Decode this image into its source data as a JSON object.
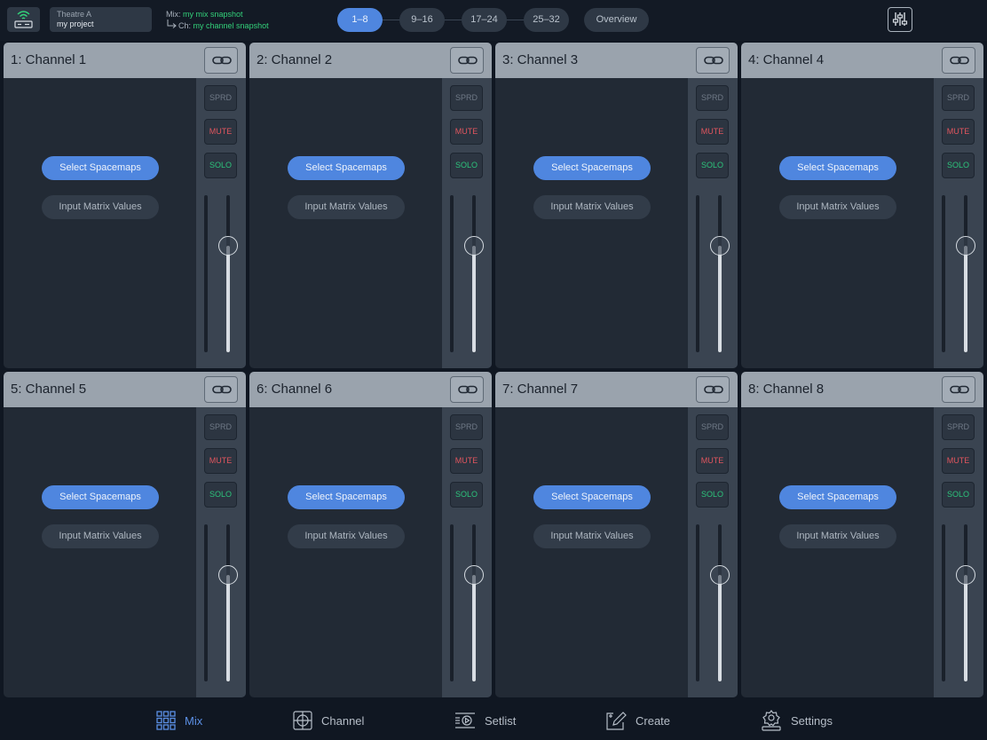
{
  "header": {
    "device_icon": "wireless-device-icon",
    "venue": "Theatre A",
    "project": "my project",
    "mix_label": "Mix:",
    "mix_snapshot": "my mix snapshot",
    "ch_label": "Ch:",
    "channel_snapshot": "my channel snapshot",
    "pages": [
      "1–8",
      "9–16",
      "17–24",
      "25–32"
    ],
    "active_page": "1–8",
    "overview_label": "Overview",
    "mixer_icon": "mixer-sliders-icon"
  },
  "channels": [
    {
      "title": "1:  Channel 1",
      "select_label": "Select Spacemaps",
      "matrix_label": "Input Matrix Values",
      "sprd": "SPRD",
      "mute": "MUTE",
      "solo": "SOLO",
      "fader_level": 0.68
    },
    {
      "title": "2:  Channel 2",
      "select_label": "Select Spacemaps",
      "matrix_label": "Input Matrix Values",
      "sprd": "SPRD",
      "mute": "MUTE",
      "solo": "SOLO",
      "fader_level": 0.68
    },
    {
      "title": "3:  Channel 3",
      "select_label": "Select Spacemaps",
      "matrix_label": "Input Matrix Values",
      "sprd": "SPRD",
      "mute": "MUTE",
      "solo": "SOLO",
      "fader_level": 0.68
    },
    {
      "title": "4:  Channel 4",
      "select_label": "Select Spacemaps",
      "matrix_label": "Input Matrix Values",
      "sprd": "SPRD",
      "mute": "MUTE",
      "solo": "SOLO",
      "fader_level": 0.68
    },
    {
      "title": "5:  Channel 5",
      "select_label": "Select Spacemaps",
      "matrix_label": "Input Matrix Values",
      "sprd": "SPRD",
      "mute": "MUTE",
      "solo": "SOLO",
      "fader_level": 0.68
    },
    {
      "title": "6:  Channel 6",
      "select_label": "Select Spacemaps",
      "matrix_label": "Input Matrix Values",
      "sprd": "SPRD",
      "mute": "MUTE",
      "solo": "SOLO",
      "fader_level": 0.68
    },
    {
      "title": "7:  Channel 7",
      "select_label": "Select Spacemaps",
      "matrix_label": "Input Matrix Values",
      "sprd": "SPRD",
      "mute": "MUTE",
      "solo": "SOLO",
      "fader_level": 0.68
    },
    {
      "title": "8:  Channel 8",
      "select_label": "Select Spacemaps",
      "matrix_label": "Input Matrix Values",
      "sprd": "SPRD",
      "mute": "MUTE",
      "solo": "SOLO",
      "fader_level": 0.68
    }
  ],
  "tabs": [
    {
      "label": "Mix",
      "icon": "mix-grid-icon",
      "active": true
    },
    {
      "label": "Channel",
      "icon": "channel-target-icon",
      "active": false
    },
    {
      "label": "Setlist",
      "icon": "setlist-icon",
      "active": false
    },
    {
      "label": "Create",
      "icon": "create-pencil-icon",
      "active": false
    },
    {
      "label": "Settings",
      "icon": "settings-gear-icon",
      "active": false
    }
  ],
  "colors": {
    "accent": "#4f86df",
    "mute": "#e0555e",
    "solo": "#2cc47b",
    "snapshot": "#33d17a"
  }
}
